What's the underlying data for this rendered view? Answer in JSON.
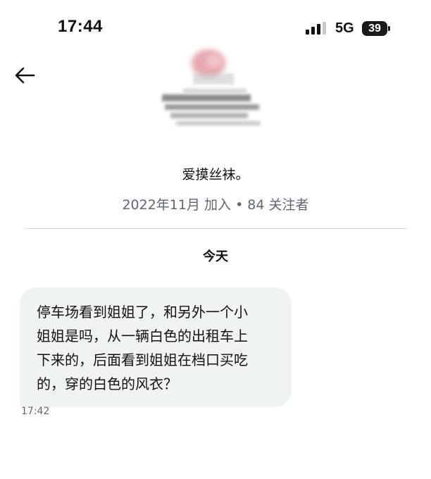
{
  "status_bar": {
    "time": "17:44",
    "network": "5G",
    "battery": "39",
    "signal_icon": "signal-bars-icon"
  },
  "header": {
    "back_icon": "back-arrow-icon"
  },
  "profile": {
    "avatar": "blurred-avatar",
    "name": "爱摸丝袜。",
    "meta": "2022年11月 加入 • 84 关注者"
  },
  "conversation": {
    "date_separator": "今天",
    "messages": [
      {
        "lines": [
          "停车场看到姐姐了，和另外一个小",
          "姐姐是吗，从一辆白色的出租车上",
          "下来的，后面看到姐姐在档口买吃",
          "的，穿的白色的风衣？"
        ],
        "time": "17:42"
      }
    ]
  },
  "colors": {
    "bubble": "#eff3f4",
    "muted_text": "#5f6670",
    "divider": "#d4d7db"
  }
}
